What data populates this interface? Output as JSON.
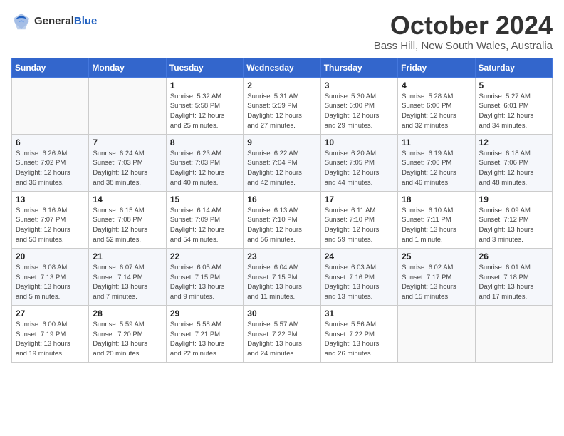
{
  "logo": {
    "general": "General",
    "blue": "Blue"
  },
  "title": {
    "month": "October 2024",
    "location": "Bass Hill, New South Wales, Australia"
  },
  "calendar": {
    "headers": [
      "Sunday",
      "Monday",
      "Tuesday",
      "Wednesday",
      "Thursday",
      "Friday",
      "Saturday"
    ],
    "weeks": [
      [
        {
          "day": "",
          "info": ""
        },
        {
          "day": "",
          "info": ""
        },
        {
          "day": "1",
          "info": "Sunrise: 5:32 AM\nSunset: 5:58 PM\nDaylight: 12 hours\nand 25 minutes."
        },
        {
          "day": "2",
          "info": "Sunrise: 5:31 AM\nSunset: 5:59 PM\nDaylight: 12 hours\nand 27 minutes."
        },
        {
          "day": "3",
          "info": "Sunrise: 5:30 AM\nSunset: 6:00 PM\nDaylight: 12 hours\nand 29 minutes."
        },
        {
          "day": "4",
          "info": "Sunrise: 5:28 AM\nSunset: 6:00 PM\nDaylight: 12 hours\nand 32 minutes."
        },
        {
          "day": "5",
          "info": "Sunrise: 5:27 AM\nSunset: 6:01 PM\nDaylight: 12 hours\nand 34 minutes."
        }
      ],
      [
        {
          "day": "6",
          "info": "Sunrise: 6:26 AM\nSunset: 7:02 PM\nDaylight: 12 hours\nand 36 minutes."
        },
        {
          "day": "7",
          "info": "Sunrise: 6:24 AM\nSunset: 7:03 PM\nDaylight: 12 hours\nand 38 minutes."
        },
        {
          "day": "8",
          "info": "Sunrise: 6:23 AM\nSunset: 7:03 PM\nDaylight: 12 hours\nand 40 minutes."
        },
        {
          "day": "9",
          "info": "Sunrise: 6:22 AM\nSunset: 7:04 PM\nDaylight: 12 hours\nand 42 minutes."
        },
        {
          "day": "10",
          "info": "Sunrise: 6:20 AM\nSunset: 7:05 PM\nDaylight: 12 hours\nand 44 minutes."
        },
        {
          "day": "11",
          "info": "Sunrise: 6:19 AM\nSunset: 7:06 PM\nDaylight: 12 hours\nand 46 minutes."
        },
        {
          "day": "12",
          "info": "Sunrise: 6:18 AM\nSunset: 7:06 PM\nDaylight: 12 hours\nand 48 minutes."
        }
      ],
      [
        {
          "day": "13",
          "info": "Sunrise: 6:16 AM\nSunset: 7:07 PM\nDaylight: 12 hours\nand 50 minutes."
        },
        {
          "day": "14",
          "info": "Sunrise: 6:15 AM\nSunset: 7:08 PM\nDaylight: 12 hours\nand 52 minutes."
        },
        {
          "day": "15",
          "info": "Sunrise: 6:14 AM\nSunset: 7:09 PM\nDaylight: 12 hours\nand 54 minutes."
        },
        {
          "day": "16",
          "info": "Sunrise: 6:13 AM\nSunset: 7:10 PM\nDaylight: 12 hours\nand 56 minutes."
        },
        {
          "day": "17",
          "info": "Sunrise: 6:11 AM\nSunset: 7:10 PM\nDaylight: 12 hours\nand 59 minutes."
        },
        {
          "day": "18",
          "info": "Sunrise: 6:10 AM\nSunset: 7:11 PM\nDaylight: 13 hours\nand 1 minute."
        },
        {
          "day": "19",
          "info": "Sunrise: 6:09 AM\nSunset: 7:12 PM\nDaylight: 13 hours\nand 3 minutes."
        }
      ],
      [
        {
          "day": "20",
          "info": "Sunrise: 6:08 AM\nSunset: 7:13 PM\nDaylight: 13 hours\nand 5 minutes."
        },
        {
          "day": "21",
          "info": "Sunrise: 6:07 AM\nSunset: 7:14 PM\nDaylight: 13 hours\nand 7 minutes."
        },
        {
          "day": "22",
          "info": "Sunrise: 6:05 AM\nSunset: 7:15 PM\nDaylight: 13 hours\nand 9 minutes."
        },
        {
          "day": "23",
          "info": "Sunrise: 6:04 AM\nSunset: 7:15 PM\nDaylight: 13 hours\nand 11 minutes."
        },
        {
          "day": "24",
          "info": "Sunrise: 6:03 AM\nSunset: 7:16 PM\nDaylight: 13 hours\nand 13 minutes."
        },
        {
          "day": "25",
          "info": "Sunrise: 6:02 AM\nSunset: 7:17 PM\nDaylight: 13 hours\nand 15 minutes."
        },
        {
          "day": "26",
          "info": "Sunrise: 6:01 AM\nSunset: 7:18 PM\nDaylight: 13 hours\nand 17 minutes."
        }
      ],
      [
        {
          "day": "27",
          "info": "Sunrise: 6:00 AM\nSunset: 7:19 PM\nDaylight: 13 hours\nand 19 minutes."
        },
        {
          "day": "28",
          "info": "Sunrise: 5:59 AM\nSunset: 7:20 PM\nDaylight: 13 hours\nand 20 minutes."
        },
        {
          "day": "29",
          "info": "Sunrise: 5:58 AM\nSunset: 7:21 PM\nDaylight: 13 hours\nand 22 minutes."
        },
        {
          "day": "30",
          "info": "Sunrise: 5:57 AM\nSunset: 7:22 PM\nDaylight: 13 hours\nand 24 minutes."
        },
        {
          "day": "31",
          "info": "Sunrise: 5:56 AM\nSunset: 7:22 PM\nDaylight: 13 hours\nand 26 minutes."
        },
        {
          "day": "",
          "info": ""
        },
        {
          "day": "",
          "info": ""
        }
      ]
    ]
  }
}
